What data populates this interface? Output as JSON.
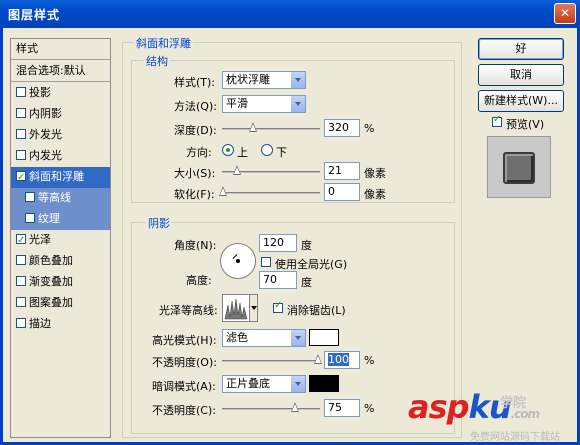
{
  "window": {
    "title": "图层样式",
    "close": "✕"
  },
  "left_list": {
    "header": "样式",
    "items": [
      {
        "label": "混合选项:默认",
        "checkbox": false,
        "has_checkbox": false
      },
      {
        "label": "投影",
        "checked": false
      },
      {
        "label": "内阴影",
        "checked": false
      },
      {
        "label": "外发光",
        "checked": false
      },
      {
        "label": "内发光",
        "checked": false
      },
      {
        "label": "斜面和浮雕",
        "checked": true
      },
      {
        "label": "等高线",
        "checked": false
      },
      {
        "label": "纹理",
        "checked": false
      },
      {
        "label": "光泽",
        "checked": true
      },
      {
        "label": "颜色叠加",
        "checked": false
      },
      {
        "label": "渐变叠加",
        "checked": false
      },
      {
        "label": "图案叠加",
        "checked": false
      },
      {
        "label": "描边",
        "checked": false
      }
    ]
  },
  "bevel": {
    "title": "斜面和浮雕",
    "structure": {
      "title": "结构",
      "style_label": "样式(T):",
      "style_value": "枕状浮雕",
      "technique_label": "方法(Q):",
      "technique_value": "平滑",
      "depth_label": "深度(D):",
      "depth_value": "320",
      "depth_unit": "%",
      "depth_level": 0.32,
      "direction_label": "方向:",
      "direction_up": "上",
      "direction_down": "下",
      "size_label": "大小(S):",
      "size_value": "21",
      "size_unit": "像素",
      "soften_label": "软化(F):",
      "soften_value": "0",
      "soften_unit": "像素"
    },
    "shading": {
      "title": "阴影",
      "angle_label": "角度(N):",
      "angle_value": "120",
      "angle_unit": "度",
      "global_light_label": "使用全局光(G)",
      "altitude_label": "高度:",
      "altitude_value": "70",
      "altitude_unit": "度",
      "gloss_label": "光泽等高线:",
      "antialias_label": "消除锯齿(L)",
      "highlight_mode_label": "高光模式(H):",
      "highlight_mode_value": "滤色",
      "highlight_color": "#ffffff",
      "highlight_opacity_label": "不透明度(O):",
      "highlight_opacity_value": "100",
      "highlight_opacity_unit": "%",
      "shadow_mode_label": "暗调模式(A):",
      "shadow_mode_value": "正片叠底",
      "shadow_color": "#000000",
      "shadow_opacity_label": "不透明度(C):",
      "shadow_opacity_value": "75",
      "shadow_opacity_unit": "%"
    }
  },
  "buttons": {
    "ok": "好",
    "cancel": "取消",
    "new_style": "新建样式(W)...",
    "preview_label": "预览(V)"
  },
  "watermark": {
    "asp": "asp",
    "ku": "ku",
    "dot": ".com",
    "cn": "学院",
    "sub": "免费网站源码下载站"
  }
}
